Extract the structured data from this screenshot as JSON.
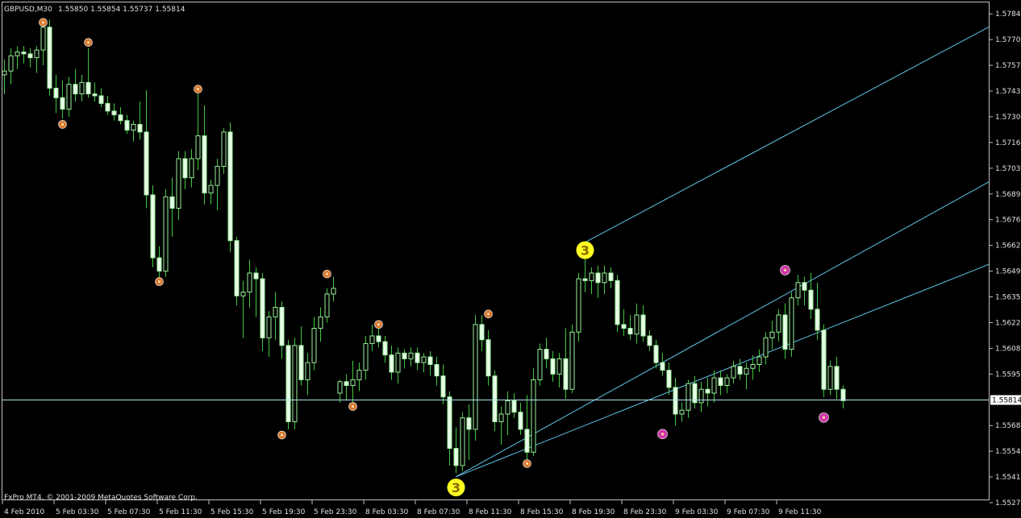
{
  "header": {
    "symbol": "GBPUSD,M30",
    "ohlc": "1.55850 1.55854 1.55737 1.55814"
  },
  "footer": {
    "copyright": "FxPro MT4, © 2001-2009 MetaQuotes Software Corp."
  },
  "colors": {
    "background": "#000000",
    "frame": "#c0c0c0",
    "candle": "#9cf29c",
    "candle_body": "#e8ffe8",
    "wick": "#42c742",
    "channel": "#5fc7e8",
    "bid_line": "#aee0e8",
    "fractal_orange": "#d77a32",
    "fractal_magenta": "#d038a8",
    "wave_label": "#ffff22"
  },
  "chart_data": {
    "type": "candlestick",
    "ylim": [
      1.55275,
      1.57862
    ],
    "y_ticks": [
      1.5784,
      1.57705,
      1.5757,
      1.57435,
      1.573,
      1.57165,
      1.5703,
      1.56895,
      1.5676,
      1.56625,
      1.5649,
      1.56355,
      1.5622,
      1.56085,
      1.5595,
      1.5568,
      1.55545,
      1.5541,
      1.55275
    ],
    "x_labels": [
      "4 Feb 2010",
      "5 Feb 03:30",
      "5 Feb 07:30",
      "5 Feb 11:30",
      "5 Feb 15:30",
      "5 Feb 19:30",
      "5 Feb 23:30",
      "8 Feb 03:30",
      "8 Feb 07:30",
      "8 Feb 11:30",
      "8 Feb 15:30",
      "8 Feb 19:30",
      "8 Feb 23:30",
      "9 Feb 03:30",
      "9 Feb 07:30",
      "9 Feb 11:30"
    ],
    "bars_per_label": 8,
    "current_price": "1.55814",
    "ohlc": [
      [
        1.5752,
        1.576,
        1.5742,
        1.5754
      ],
      [
        1.5754,
        1.5766,
        1.5747,
        1.5762
      ],
      [
        1.5762,
        1.5767,
        1.5755,
        1.5764
      ],
      [
        1.5764,
        1.5767,
        1.5758,
        1.5763
      ],
      [
        1.5763,
        1.5766,
        1.5756,
        1.5761
      ],
      [
        1.5761,
        1.5767,
        1.5753,
        1.5765
      ],
      [
        1.5765,
        1.578,
        1.5757,
        1.5777
      ],
      [
        1.5777,
        1.5781,
        1.5741,
        1.5745
      ],
      [
        1.5745,
        1.5752,
        1.5732,
        1.574
      ],
      [
        1.574,
        1.5749,
        1.5729,
        1.5734
      ],
      [
        1.5734,
        1.5751,
        1.573,
        1.5747
      ],
      [
        1.5747,
        1.5755,
        1.5738,
        1.5742
      ],
      [
        1.5742,
        1.5752,
        1.5738,
        1.5748
      ],
      [
        1.5748,
        1.5766,
        1.574,
        1.5742
      ],
      [
        1.5742,
        1.5748,
        1.5738,
        1.5741
      ],
      [
        1.5741,
        1.5745,
        1.5735,
        1.5737
      ],
      [
        1.5737,
        1.5741,
        1.5731,
        1.5733
      ],
      [
        1.5733,
        1.5737,
        1.5728,
        1.5731
      ],
      [
        1.5731,
        1.5735,
        1.5726,
        1.5728
      ],
      [
        1.5728,
        1.5731,
        1.5721,
        1.5723
      ],
      [
        1.5723,
        1.5728,
        1.5717,
        1.5726
      ],
      [
        1.5726,
        1.5738,
        1.5718,
        1.5722
      ],
      [
        1.5722,
        1.5744,
        1.5682,
        1.5689
      ],
      [
        1.5689,
        1.5694,
        1.5651,
        1.5656
      ],
      [
        1.5656,
        1.5662,
        1.5645,
        1.5649
      ],
      [
        1.5649,
        1.5692,
        1.5646,
        1.5688
      ],
      [
        1.5688,
        1.5698,
        1.5667,
        1.5682
      ],
      [
        1.5682,
        1.5712,
        1.5676,
        1.5708
      ],
      [
        1.5708,
        1.5712,
        1.5692,
        1.5698
      ],
      [
        1.5698,
        1.5713,
        1.5693,
        1.5708
      ],
      [
        1.5708,
        1.5742,
        1.5702,
        1.572
      ],
      [
        1.572,
        1.5736,
        1.5684,
        1.569
      ],
      [
        1.569,
        1.5697,
        1.5684,
        1.5694
      ],
      [
        1.5694,
        1.5708,
        1.5681,
        1.5704
      ],
      [
        1.5704,
        1.5724,
        1.57,
        1.5722
      ],
      [
        1.5722,
        1.5727,
        1.5659,
        1.5665
      ],
      [
        1.5665,
        1.5667,
        1.5631,
        1.5636
      ],
      [
        1.5636,
        1.5644,
        1.5614,
        1.5638
      ],
      [
        1.5638,
        1.5655,
        1.563,
        1.5648
      ],
      [
        1.5648,
        1.5651,
        1.5625,
        1.5645
      ],
      [
        1.5645,
        1.5648,
        1.5607,
        1.5614
      ],
      [
        1.5614,
        1.5628,
        1.5604,
        1.5625
      ],
      [
        1.5625,
        1.5638,
        1.5613,
        1.563
      ],
      [
        1.563,
        1.5633,
        1.5603,
        1.561
      ],
      [
        1.561,
        1.5613,
        1.5566,
        1.557
      ],
      [
        1.557,
        1.5614,
        1.5566,
        1.561
      ],
      [
        1.561,
        1.562,
        1.5589,
        1.5592
      ],
      [
        1.5592,
        1.5606,
        1.5584,
        1.5601
      ],
      [
        1.5601,
        1.5625,
        1.5597,
        1.5619
      ],
      [
        1.5619,
        1.563,
        1.5612,
        1.5625
      ],
      [
        1.5625,
        1.564,
        1.5622,
        1.5637
      ],
      [
        1.5637,
        1.5646,
        1.5633,
        1.564
      ],
      [
        1.5585,
        1.5592,
        1.558,
        1.5591
      ],
      [
        1.5591,
        1.5595,
        1.5581,
        1.5589
      ],
      [
        1.5589,
        1.5602,
        1.5578,
        1.5592
      ],
      [
        1.5592,
        1.5601,
        1.5586,
        1.5597
      ],
      [
        1.5597,
        1.5615,
        1.5592,
        1.5611
      ],
      [
        1.5611,
        1.5621,
        1.5607,
        1.5615
      ],
      [
        1.5615,
        1.562,
        1.5609,
        1.5612
      ],
      [
        1.5612,
        1.5615,
        1.5601,
        1.5605
      ],
      [
        1.5605,
        1.561,
        1.5592,
        1.5596
      ],
      [
        1.5596,
        1.5609,
        1.559,
        1.5606
      ],
      [
        1.5606,
        1.5608,
        1.5598,
        1.5603
      ],
      [
        1.5603,
        1.5609,
        1.5599,
        1.5606
      ],
      [
        1.5606,
        1.5609,
        1.5597,
        1.5601
      ],
      [
        1.5601,
        1.5606,
        1.5596,
        1.5604
      ],
      [
        1.5604,
        1.5607,
        1.5594,
        1.56
      ],
      [
        1.56,
        1.5604,
        1.5589,
        1.5594
      ],
      [
        1.5594,
        1.56,
        1.5579,
        1.5583
      ],
      [
        1.5583,
        1.5586,
        1.5547,
        1.5556
      ],
      [
        1.5556,
        1.5567,
        1.5543,
        1.5547
      ],
      [
        1.5547,
        1.5575,
        1.5544,
        1.5572
      ],
      [
        1.5572,
        1.5579,
        1.555,
        1.5566
      ],
      [
        1.5566,
        1.5626,
        1.556,
        1.5621
      ],
      [
        1.5621,
        1.5626,
        1.5607,
        1.5613
      ],
      [
        1.5613,
        1.5618,
        1.5589,
        1.5594
      ],
      [
        1.5594,
        1.5597,
        1.5565,
        1.557
      ],
      [
        1.557,
        1.5578,
        1.5558,
        1.5574
      ],
      [
        1.5574,
        1.5586,
        1.5563,
        1.5581
      ],
      [
        1.5581,
        1.5585,
        1.5572,
        1.5575
      ],
      [
        1.5575,
        1.558,
        1.5563,
        1.5566
      ],
      [
        1.5566,
        1.5584,
        1.555,
        1.5554
      ],
      [
        1.5554,
        1.5598,
        1.5552,
        1.5592
      ],
      [
        1.5592,
        1.5611,
        1.5589,
        1.5608
      ],
      [
        1.5608,
        1.5614,
        1.5598,
        1.5603
      ],
      [
        1.5603,
        1.5607,
        1.5591,
        1.5595
      ],
      [
        1.5595,
        1.5606,
        1.5588,
        1.5603
      ],
      [
        1.5603,
        1.5619,
        1.5582,
        1.5587
      ],
      [
        1.5587,
        1.5621,
        1.5585,
        1.5617
      ],
      [
        1.5617,
        1.5648,
        1.5612,
        1.5645
      ],
      [
        1.5645,
        1.5658,
        1.5638,
        1.5644
      ],
      [
        1.5644,
        1.5651,
        1.5637,
        1.5648
      ],
      [
        1.5648,
        1.5652,
        1.5635,
        1.5643
      ],
      [
        1.5643,
        1.5652,
        1.5637,
        1.5648
      ],
      [
        1.5648,
        1.5651,
        1.564,
        1.5644
      ],
      [
        1.5644,
        1.5647,
        1.5617,
        1.5621
      ],
      [
        1.5621,
        1.5629,
        1.5615,
        1.5619
      ],
      [
        1.5619,
        1.5626,
        1.5613,
        1.5616
      ],
      [
        1.5616,
        1.5632,
        1.5611,
        1.5626
      ],
      [
        1.5626,
        1.5631,
        1.5612,
        1.5615
      ],
      [
        1.5615,
        1.5618,
        1.5607,
        1.561
      ],
      [
        1.561,
        1.5613,
        1.5598,
        1.5601
      ],
      [
        1.5601,
        1.5606,
        1.5594,
        1.5597
      ],
      [
        1.5597,
        1.5601,
        1.5584,
        1.5588
      ],
      [
        1.5588,
        1.5593,
        1.5568,
        1.5574
      ],
      [
        1.5574,
        1.558,
        1.557,
        1.5576
      ],
      [
        1.5576,
        1.5592,
        1.5572,
        1.559
      ],
      [
        1.559,
        1.5594,
        1.5577,
        1.558
      ],
      [
        1.558,
        1.5591,
        1.5575,
        1.5587
      ],
      [
        1.5587,
        1.5593,
        1.5578,
        1.5585
      ],
      [
        1.5585,
        1.5597,
        1.558,
        1.5593
      ],
      [
        1.5593,
        1.5597,
        1.5584,
        1.5589
      ],
      [
        1.5589,
        1.5595,
        1.5585,
        1.5593
      ],
      [
        1.5593,
        1.5602,
        1.559,
        1.5599
      ],
      [
        1.5599,
        1.5603,
        1.5592,
        1.5595
      ],
      [
        1.5595,
        1.5601,
        1.5587,
        1.5598
      ],
      [
        1.5598,
        1.5605,
        1.5592,
        1.56
      ],
      [
        1.56,
        1.5608,
        1.5596,
        1.5604
      ],
      [
        1.5604,
        1.5617,
        1.56,
        1.5614
      ],
      [
        1.5614,
        1.5623,
        1.5608,
        1.5617
      ],
      [
        1.5617,
        1.5629,
        1.5612,
        1.5626
      ],
      [
        1.5626,
        1.5632,
        1.5603,
        1.5608
      ],
      [
        1.5608,
        1.5638,
        1.5604,
        1.5635
      ],
      [
        1.5635,
        1.5647,
        1.5631,
        1.5643
      ],
      [
        1.5643,
        1.5646,
        1.5631,
        1.5639
      ],
      [
        1.5639,
        1.5648,
        1.5624,
        1.5629
      ],
      [
        1.5629,
        1.5643,
        1.5613,
        1.5618
      ],
      [
        1.5618,
        1.5621,
        1.5583,
        1.5587
      ],
      [
        1.5587,
        1.5602,
        1.5584,
        1.5599
      ],
      [
        1.5599,
        1.5604,
        1.5582,
        1.5587
      ],
      [
        1.5587,
        1.5589,
        1.5577,
        1.5581
      ]
    ],
    "fractals": [
      {
        "bar": 6,
        "price": 1.57795,
        "color": "orange"
      },
      {
        "bar": 9,
        "price": 1.5726,
        "color": "orange"
      },
      {
        "bar": 13,
        "price": 1.5769,
        "color": "orange"
      },
      {
        "bar": 24,
        "price": 1.56435,
        "color": "orange"
      },
      {
        "bar": 30,
        "price": 1.57445,
        "color": "orange"
      },
      {
        "bar": 43,
        "price": 1.5563,
        "color": "orange"
      },
      {
        "bar": 50,
        "price": 1.56475,
        "color": "orange"
      },
      {
        "bar": 54,
        "price": 1.5578,
        "color": "orange"
      },
      {
        "bar": 58,
        "price": 1.5621,
        "color": "orange"
      },
      {
        "bar": 75,
        "price": 1.56265,
        "color": "orange"
      },
      {
        "bar": 81,
        "price": 1.5548,
        "color": "orange"
      },
      {
        "bar": 102,
        "price": 1.55635,
        "color": "magenta"
      },
      {
        "bar": 121,
        "price": 1.56495,
        "color": "magenta"
      },
      {
        "bar": 127,
        "price": 1.55722,
        "color": "magenta"
      }
    ],
    "wave_labels": [
      {
        "bar": 70,
        "price": 1.55355,
        "text": "3"
      },
      {
        "bar": 90,
        "price": 1.566,
        "text": "3"
      }
    ],
    "channel_lines": [
      {
        "from": [
          70,
          1.5541
        ],
        "to": [
          170,
          1.5676
        ]
      },
      {
        "from": [
          90,
          1.5664
        ],
        "to": [
          157,
          1.5785
        ]
      },
      {
        "from": [
          70,
          1.5541
        ],
        "to": [
          157,
          1.5704
        ]
      }
    ]
  }
}
